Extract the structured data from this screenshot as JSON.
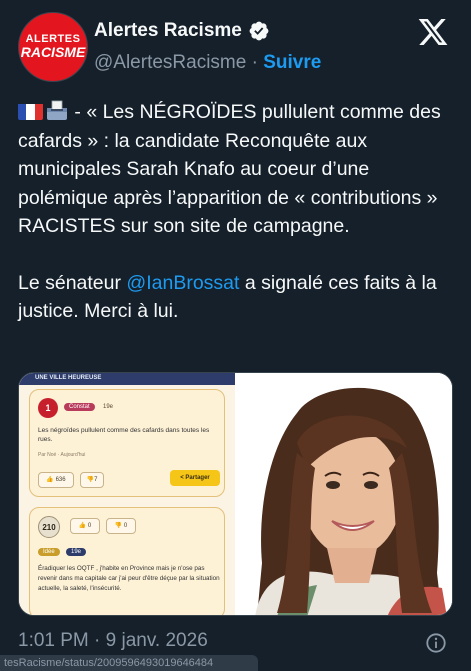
{
  "account": {
    "display_name": "Alertes Racisme",
    "handle": "@AlertesRacisme",
    "separator": "·",
    "follow_label": "Suivre",
    "avatar_line1": "ALERTES",
    "avatar_line2": "RACISME",
    "verified_icon": "verified-badge-icon",
    "brand_color": "#e3161f"
  },
  "platform_logo": "x-logo-icon",
  "tweet": {
    "line1_after_emoji": " - « Les NÉGROÏDES pullulent comme des cafards » : la candidate Reconquête aux municipales Sarah Knafo au coeur d’une polémique après l’apparition de « contributions » RACISTES sur son site de campagne.",
    "p2_before": "Le sénateur ",
    "p2_mention": "@IanBrossat",
    "p2_after": " a signalé ces faits à la justice. Merci à lui.",
    "emojis": [
      "french-flag-icon",
      "ballot-box-icon"
    ]
  },
  "media": {
    "left_image": {
      "header_label": "UNE VILLE HEUREUSE",
      "card1": {
        "number": "1",
        "tag_constat": "Constat",
        "tag_district": "19e",
        "text": "Les négroïdes pullulent comme des cafards dans toutes les rues.",
        "meta": "Par Noé  ·  Aujourd'hui",
        "votes_up": "636",
        "votes_down": "7",
        "share_label": "Partager"
      },
      "card2": {
        "score": "210",
        "votes_up": "0",
        "votes_down": "0",
        "tag_idee": "Idée",
        "tag_district": "19e",
        "text": "Éradiquer les OQTF , j'habite en Province mais je n'ose pas revenir dans ma capitale car j'ai peur d'être déçue par la situation actuelle, la saleté, l'insécurité."
      }
    },
    "right_image": {
      "subject": "portrait-photo"
    }
  },
  "footer": {
    "timestamp": "1:01 PM · 9 janv. 2026",
    "info_icon": "info-icon",
    "status_url": "tesRacisme/status/2009596493019646484"
  },
  "colors": {
    "background": "#15202b",
    "text": "#f7f9f9",
    "secondary": "#8b98a5",
    "link": "#1d9bf0"
  }
}
